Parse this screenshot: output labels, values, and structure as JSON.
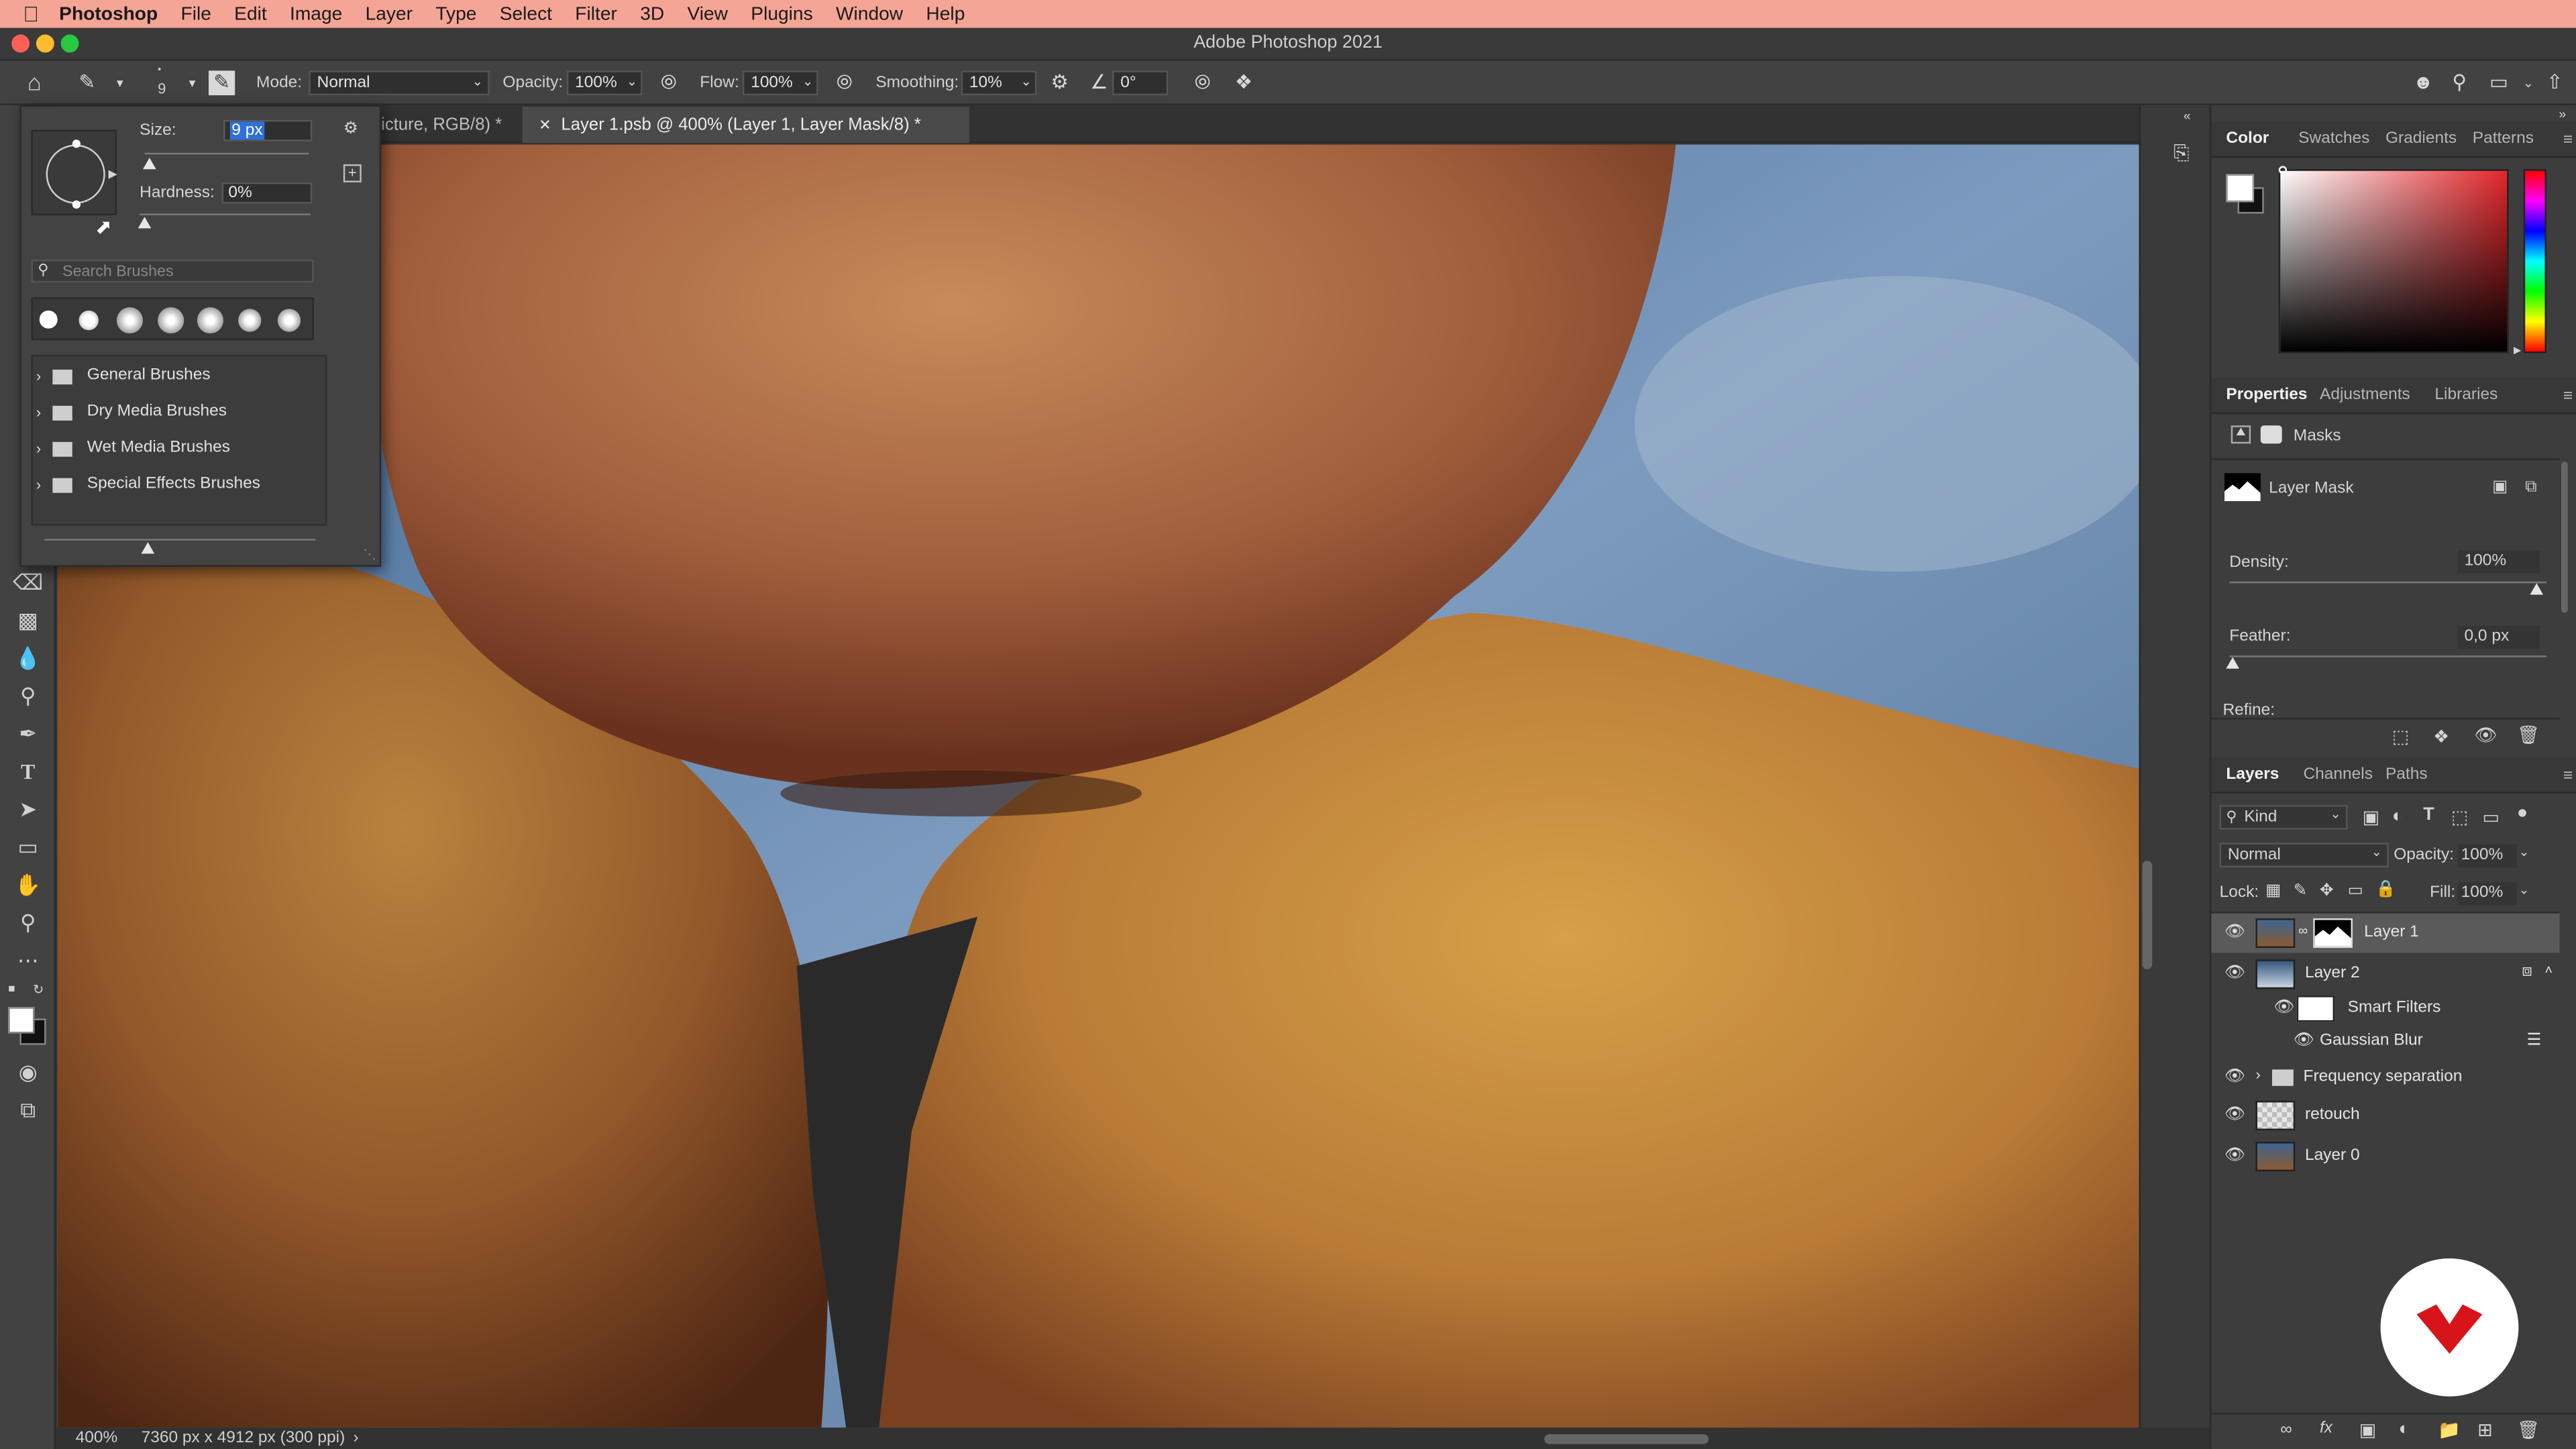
{
  "menubar": {
    "app": "Photoshop",
    "items": [
      "File",
      "Edit",
      "Image",
      "Layer",
      "Type",
      "Select",
      "Filter",
      "3D",
      "View",
      "Plugins",
      "Window",
      "Help"
    ]
  },
  "window": {
    "title": "Adobe Photoshop 2021"
  },
  "options": {
    "brush_size": "9",
    "mode_label": "Mode:",
    "mode_value": "Normal",
    "opacity_label": "Opacity:",
    "opacity_value": "100%",
    "flow_label": "Flow:",
    "flow_value": "100%",
    "smoothing_label": "Smoothing:",
    "smoothing_value": "10%",
    "angle_value": "0°"
  },
  "tabs": [
    {
      "label": "icture, RGB/8) *"
    },
    {
      "label": "Layer 1.psb @ 400% (Layer 1, Layer Mask/8) *"
    }
  ],
  "brush_popover": {
    "size_label": "Size:",
    "size_value": "9 px",
    "hardness_label": "Hardness:",
    "hardness_value": "0%",
    "search_placeholder": "Search Brushes",
    "folders": [
      "General Brushes",
      "Dry Media Brushes",
      "Wet Media Brushes",
      "Special Effects Brushes"
    ]
  },
  "color_panel": {
    "tabs": [
      "Color",
      "Swatches",
      "Gradients",
      "Patterns"
    ]
  },
  "properties_panel": {
    "tabs": [
      "Properties",
      "Adjustments",
      "Libraries"
    ],
    "section": "Masks",
    "mask_label": "Layer Mask",
    "density_label": "Density:",
    "density_value": "100%",
    "feather_label": "Feather:",
    "feather_value": "0,0 px",
    "refine_label": "Refine:"
  },
  "layers_panel": {
    "tabs": [
      "Layers",
      "Channels",
      "Paths"
    ],
    "kind_label": "Kind",
    "blend_mode": "Normal",
    "opacity_label": "Opacity:",
    "opacity_value": "100%",
    "lock_label": "Lock:",
    "fill_label": "Fill:",
    "fill_value": "100%",
    "layers": {
      "layer1": "Layer 1",
      "layer2": "Layer 2",
      "smart_filters": "Smart Filters",
      "gaussian_blur": "Gaussian Blur",
      "freq_sep": "Frequency separation",
      "retouch": "retouch",
      "layer0": "Layer 0"
    }
  },
  "status": {
    "zoom": "400%",
    "doc_info": "7360 px x 4912 px (300 ppi)"
  },
  "colors": {
    "menubar_bg": "#f5a596",
    "accent_blue": "#2f6fd8",
    "logo_red": "#d7141a"
  }
}
